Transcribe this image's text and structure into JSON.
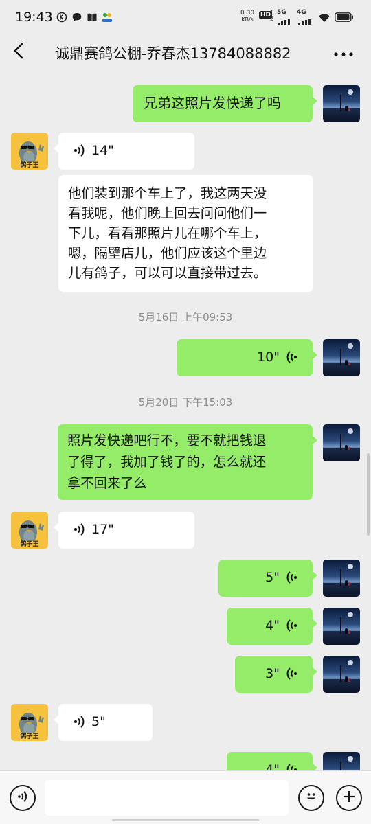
{
  "status_bar": {
    "time": "19:43",
    "net_speed": "0.30",
    "net_unit": "KB/s",
    "hd_label": "HD",
    "hd_sub": "1 2",
    "sim1_label": "5G",
    "sim2_label": "4G",
    "icons": [
      "k-circle-icon",
      "chat-bubble-icon",
      "book-icon",
      "app-badge-icon",
      "wifi-icon",
      "battery-icon"
    ]
  },
  "header": {
    "title": "诚鼎赛鸽公棚-乔春杰13784088882",
    "back_icon": "chevron-left-icon",
    "more_icon": "more-dots-icon"
  },
  "contact_avatar": {
    "label": "鸽子王",
    "color": "#f6c23e"
  },
  "messages": [
    {
      "side": "out",
      "type": "text",
      "text": "兄弟这照片发快递了吗"
    },
    {
      "side": "in",
      "type": "voice",
      "duration": "14\""
    },
    {
      "side": "in",
      "type": "text",
      "lines": [
        "他们装到那个车上了，我这两天没",
        "看我呢，他们晚上回去问问他们一",
        "下儿，看看那照片儿在哪个车上，",
        "嗯，隔壁店儿，他们应该这个里边",
        "儿有鸽子，可以可以直接带过去。"
      ]
    },
    {
      "type": "timestamp",
      "text": "5月16日 上午09:53"
    },
    {
      "side": "out",
      "type": "voice",
      "duration": "10\""
    },
    {
      "type": "timestamp",
      "text": "5月20日 下午15:03"
    },
    {
      "side": "out",
      "type": "text",
      "lines": [
        "照片发快递吧行不，要不就把钱退",
        "了得了，我加了钱了的，怎么就还",
        "拿不回来了么"
      ]
    },
    {
      "side": "in",
      "type": "voice",
      "duration": "17\""
    },
    {
      "side": "out",
      "type": "voice",
      "duration": "5\""
    },
    {
      "side": "out",
      "type": "voice",
      "duration": "4\""
    },
    {
      "side": "out",
      "type": "voice",
      "duration": "3\""
    },
    {
      "side": "in",
      "type": "voice",
      "duration": "5\""
    },
    {
      "side": "out",
      "type": "voice",
      "duration": "4\""
    }
  ],
  "bottom_bar": {
    "voice_icon": "voice-mode-icon",
    "emoji_icon": "emoji-icon",
    "plus_icon": "plus-icon",
    "input_value": ""
  },
  "colors": {
    "outgoing_bubble": "#95ec69",
    "incoming_bubble": "#ffffff",
    "background": "#ededed",
    "timestamp_text": "#8c8c8c"
  }
}
